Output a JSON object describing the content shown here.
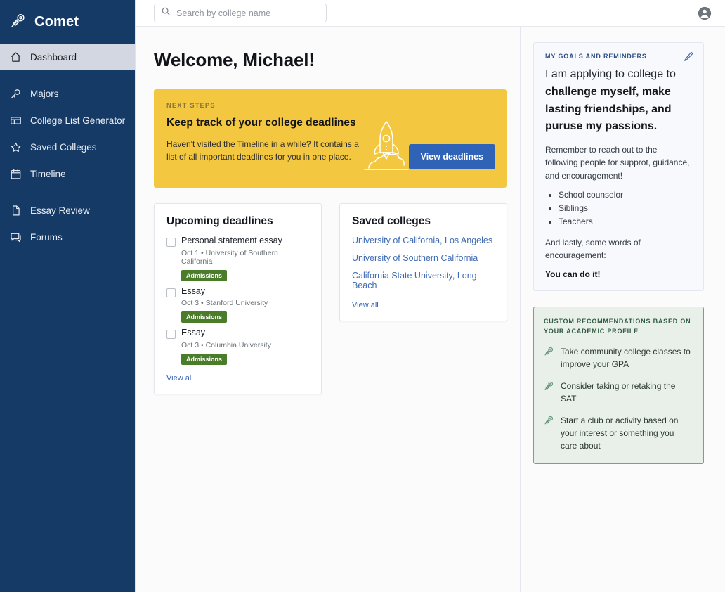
{
  "brand": {
    "name": "Comet",
    "logo_icon": "comet-icon"
  },
  "sidebar": {
    "items": [
      {
        "label": "Dashboard",
        "icon": "home-icon",
        "active": true
      },
      {
        "label": "Majors",
        "icon": "key-icon",
        "active": false
      },
      {
        "label": "College List Generator",
        "icon": "table-icon",
        "active": false
      },
      {
        "label": "Saved Colleges",
        "icon": "star-icon",
        "active": false
      },
      {
        "label": "Timeline",
        "icon": "calendar-icon",
        "active": false
      },
      {
        "label": "Essay Review",
        "icon": "document-icon",
        "active": false
      },
      {
        "label": "Forums",
        "icon": "chat-icon",
        "active": false
      }
    ]
  },
  "topbar": {
    "search_placeholder": "Search by college name",
    "search_value": "",
    "search_icon": "search-icon",
    "avatar_icon": "account-circle-icon"
  },
  "page": {
    "title": "Welcome, Michael!"
  },
  "banner": {
    "kicker": "NEXT STEPS",
    "title": "Keep track of your college deadlines",
    "body": "Haven't visited the Timeline in a while? It contains a list of all important deadlines for you in one place.",
    "button_label": "View deadlines",
    "art_icon": "rocket-icon",
    "bg_color": "#f4c740",
    "button_color": "#2e63b8"
  },
  "deadlines_card": {
    "title": "Upcoming deadlines",
    "items": [
      {
        "name": "Personal statement essay",
        "meta": "Oct 1 • University of Southern California",
        "badge": "Admissions"
      },
      {
        "name": "Essay",
        "meta": "Oct 3 • Stanford University",
        "badge": "Admissions"
      },
      {
        "name": "Essay",
        "meta": "Oct 3 • Columbia University",
        "badge": "Admissions"
      }
    ],
    "view_all": "View all",
    "badge_color": "#4a7c2a"
  },
  "saved_card": {
    "title": "Saved colleges",
    "colleges": [
      "University of California, Los Angeles",
      "University of Southern California",
      "California State University, Long Beach"
    ],
    "view_all": "View all",
    "link_color": "#3f6bb5"
  },
  "goals_card": {
    "heading": "MY GOALS AND REMINDERS",
    "edit_icon": "pencil-icon",
    "intro_plain": "I am applying to college to ",
    "intro_bold": "challenge myself, make lasting friendships, and puruse my passions.",
    "paragraph": "Remember to reach out to the following people for supprot, guidance, and encouragement!",
    "people": [
      "School counselor",
      "Siblings",
      "Teachers"
    ],
    "closing": "And lastly, some words of encouragement:",
    "encouragement": "You can do it!"
  },
  "recommendations_card": {
    "heading": "CUSTOM RECOMMENDATIONS BASED ON YOUR ACADEMIC PROFILE",
    "items": [
      {
        "icon": "comet-icon",
        "text": "Take community college classes to improve your GPA"
      },
      {
        "icon": "comet-icon",
        "text": "Consider taking or retaking the SAT"
      },
      {
        "icon": "comet-icon",
        "text": "Start a club or activity based on your interest or something you care about"
      }
    ],
    "border_color": "#7ba089",
    "bg_color": "#e9f0ea"
  }
}
